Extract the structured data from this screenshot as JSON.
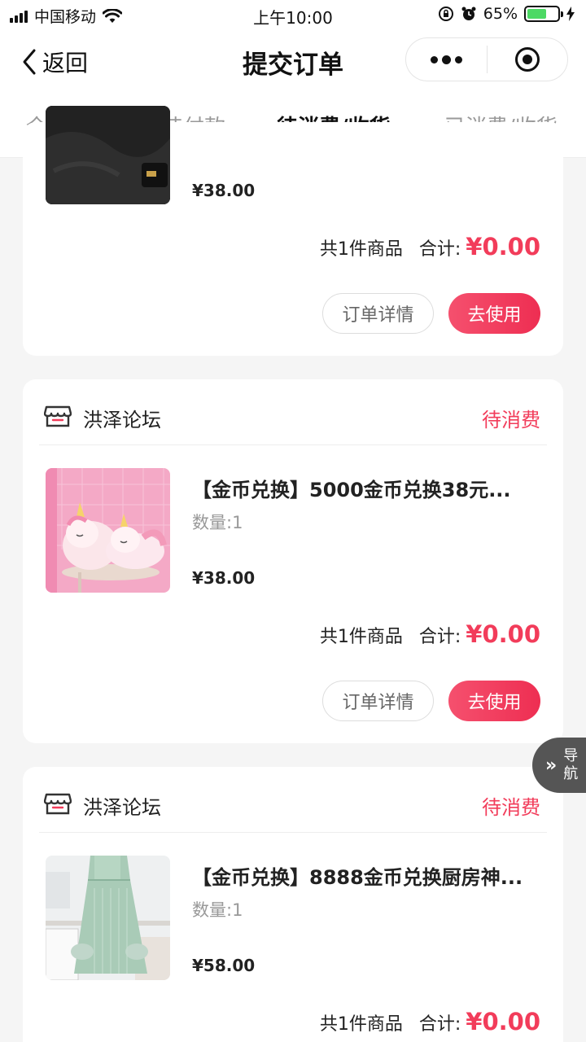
{
  "status_bar": {
    "carrier": "中国移动",
    "time": "上午10:00",
    "battery": "65%",
    "battery_level": 0.65
  },
  "nav": {
    "back_label": "返回",
    "title": "提交订单"
  },
  "tabs": [
    {
      "label": "全部订单",
      "active": false
    },
    {
      "label": "待付款",
      "active": false
    },
    {
      "label": "待消费/收货",
      "active": true
    },
    {
      "label": "已消费/收货",
      "active": false
    }
  ],
  "orders": [
    {
      "price": "¥38.00",
      "count_text": "共1件商品",
      "total_label": "合计:",
      "total": "¥0.00",
      "detail_btn": "订单详情",
      "use_btn": "去使用"
    },
    {
      "shop": "洪泽论坛",
      "status": "待消费",
      "title": "【金币兑换】5000金币兑换38元...",
      "qty": "数量:1",
      "price": "¥38.00",
      "count_text": "共1件商品",
      "total_label": "合计:",
      "total": "¥0.00",
      "detail_btn": "订单详情",
      "use_btn": "去使用"
    },
    {
      "shop": "洪泽论坛",
      "status": "待消费",
      "title": "【金币兑换】8888金币兑换厨房神...",
      "qty": "数量:1",
      "price": "¥58.00",
      "count_text": "共1件商品",
      "total_label": "合计:",
      "total": "¥0.00"
    }
  ],
  "float_nav": {
    "label": "导航"
  },
  "colors": {
    "accent": "#f23c5a",
    "background": "#f5f5f5"
  }
}
